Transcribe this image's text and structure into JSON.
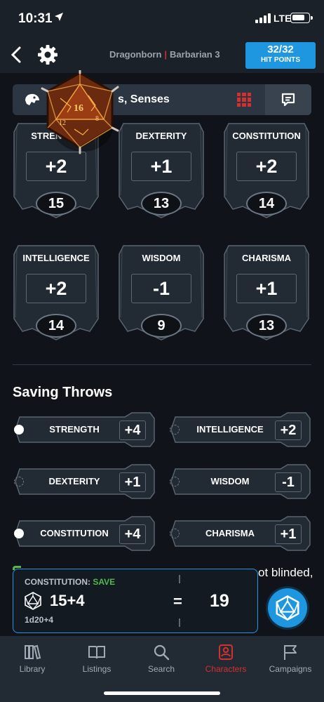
{
  "status_bar": {
    "time": "10:31",
    "network": "LTE"
  },
  "header": {
    "race": "Dragonborn",
    "class_level": "Barbarian 3",
    "hp_value": "32/32",
    "hp_label": "HIT POINTS"
  },
  "tab": {
    "label": "s, Senses"
  },
  "abilities": [
    {
      "name": "STRENGTH",
      "modifier": "+2",
      "score": "15"
    },
    {
      "name": "DEXTERITY",
      "modifier": "+1",
      "score": "13"
    },
    {
      "name": "CONSTITUTION",
      "modifier": "+2",
      "score": "14"
    },
    {
      "name": "INTELLIGENCE",
      "modifier": "+2",
      "score": "14"
    },
    {
      "name": "WISDOM",
      "modifier": "-1",
      "score": "9"
    },
    {
      "name": "CHARISMA",
      "modifier": "+1",
      "score": "13"
    }
  ],
  "saving_throws": {
    "title": "Saving Throws",
    "items": [
      {
        "name": "STRENGTH",
        "bonus": "+4",
        "proficient": true
      },
      {
        "name": "INTELLIGENCE",
        "bonus": "+2",
        "proficient": false
      },
      {
        "name": "DEXTERITY",
        "bonus": "+1",
        "proficient": false
      },
      {
        "name": "WISDOM",
        "bonus": "-1",
        "proficient": false
      },
      {
        "name": "CONSTITUTION",
        "bonus": "+4",
        "proficient": true
      },
      {
        "name": "CHARISMA",
        "bonus": "+1",
        "proficient": false
      }
    ]
  },
  "background_text": "ot blinded,",
  "roll": {
    "label": "CONSTITUTION:",
    "type": "SAVE",
    "expression": "15+4",
    "equals": "=",
    "total": "19",
    "formula": "1d20+4"
  },
  "bottom_nav": [
    {
      "label": "Library",
      "icon": "library-icon",
      "active": false
    },
    {
      "label": "Listings",
      "icon": "book-icon",
      "active": false
    },
    {
      "label": "Search",
      "icon": "search-icon",
      "active": false
    },
    {
      "label": "Characters",
      "icon": "character-icon",
      "active": true
    },
    {
      "label": "Campaigns",
      "icon": "flag-icon",
      "active": false
    }
  ],
  "colors": {
    "accent_blue": "#1e97e0",
    "accent_red": "#d43030",
    "save_green": "#52b94c",
    "background": "#10141a"
  }
}
